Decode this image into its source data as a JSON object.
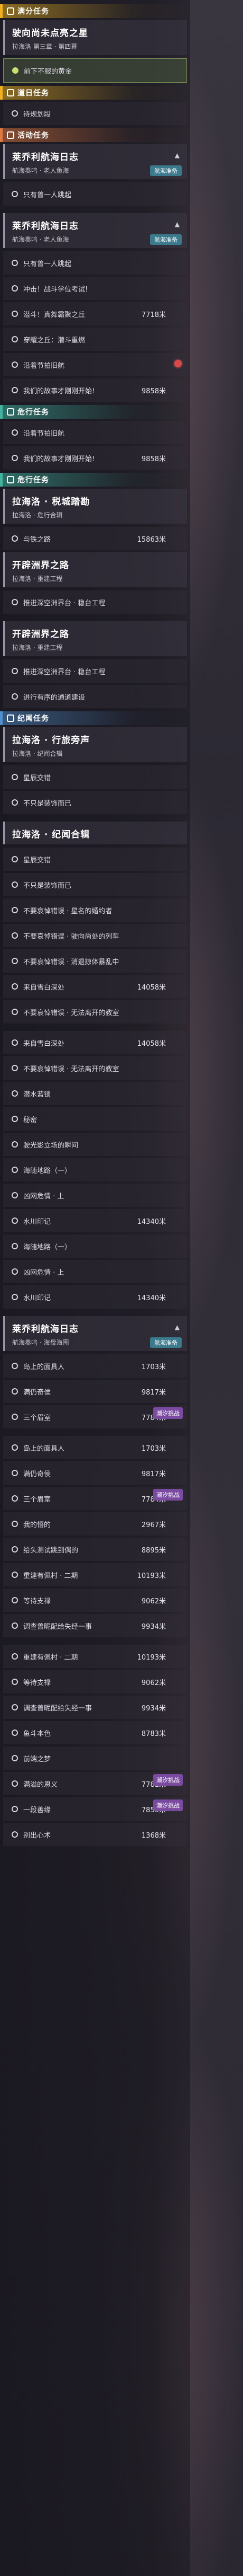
{
  "colors": {
    "trailblaze": "#f0b020",
    "companion": "#e07840",
    "adventure": "#40b4a0",
    "daily": "#5090d0",
    "active_step": "#c8e070",
    "marker": "#d84a4a"
  },
  "items": [
    {
      "k": "cat",
      "c": "yellow",
      "label": "满分任务"
    },
    {
      "k": "quest",
      "title": "驶向尚未点亮之星",
      "sub": "拉海洛 第三章 · 第四幕"
    },
    {
      "k": "step",
      "text": "前下不服的黄金",
      "active": true
    },
    {
      "k": "cat",
      "c": "yellow",
      "label": "道日任务"
    },
    {
      "k": "step",
      "text": "待规划段"
    },
    {
      "k": "cat",
      "c": "orange",
      "label": "活动任务"
    },
    {
      "k": "quest",
      "title": "莱乔利航海日志",
      "sub": "航海奏鸣 · 老人鱼海",
      "tag": "航海准备",
      "arrow": true
    },
    {
      "k": "step",
      "text": "只有曾一人跳起"
    },
    {
      "k": "gap"
    },
    {
      "k": "quest",
      "title": "莱乔利航海日志",
      "sub": "航海奏鸣 · 老人鱼海",
      "tag": "航海准备",
      "arrow": true
    },
    {
      "k": "step",
      "text": "只有曾一人跳起"
    },
    {
      "k": "step",
      "text": "冲击！战斗学位考试!"
    },
    {
      "k": "step",
      "text": "潜斗！真舞霸聚之丘",
      "dist": "7718米"
    },
    {
      "k": "step",
      "text": "穿耀之丘：潜斗重燃"
    },
    {
      "k": "step",
      "text": "沿着节拍旧航",
      "marker": true
    },
    {
      "k": "step",
      "text": "我们的故事才刚刚开始!",
      "dist": "9858米"
    },
    {
      "k": "cat",
      "c": "teal",
      "label": "危行任务"
    },
    {
      "k": "step",
      "text": "沿着节拍旧航"
    },
    {
      "k": "step",
      "text": "我们的故事才刚刚开始!",
      "dist": "9858米"
    },
    {
      "k": "cat",
      "c": "teal",
      "label": "危行任务"
    },
    {
      "k": "quest",
      "title": "拉海洛 · 税城踏勘",
      "sub": "拉海洛 · 危行合辑"
    },
    {
      "k": "step",
      "text": "与铁之路",
      "dist": "15863米"
    },
    {
      "k": "quest",
      "title": "开辟洲界之路",
      "sub": "拉海洛 · 重建工程"
    },
    {
      "k": "step",
      "text": "推进深空洲界台 · 稳台工程"
    },
    {
      "k": "gap"
    },
    {
      "k": "quest",
      "title": "开辟洲界之路",
      "sub": "拉海洛 · 重建工程"
    },
    {
      "k": "step",
      "text": "推进深空洲界台 · 稳台工程"
    },
    {
      "k": "step",
      "text": "进行有序的通道建设"
    },
    {
      "k": "cat",
      "c": "blue",
      "label": "纪闻任务"
    },
    {
      "k": "quest",
      "title": "拉海洛 · 行旅旁声",
      "sub": "拉海洛 · 纪闻合辑"
    },
    {
      "k": "step",
      "text": "星辰交错"
    },
    {
      "k": "step",
      "text": "不只是装饰而已"
    },
    {
      "k": "gap"
    },
    {
      "k": "quest",
      "title": "拉海洛 · 纪闻合辑",
      "sub": "",
      "sub_only": true
    },
    {
      "k": "step",
      "text": "星辰交错"
    },
    {
      "k": "step",
      "text": "不只是装饰而已"
    },
    {
      "k": "step",
      "text": "不要哀悼错误 · 星名的婚约者"
    },
    {
      "k": "step",
      "text": "不要哀悼错误 · 驶向尚处的列车"
    },
    {
      "k": "step",
      "text": "不要哀悼错误 · 消退掠体暴乱中"
    },
    {
      "k": "step",
      "text": "来自雪白深处",
      "dist": "14058米"
    },
    {
      "k": "step",
      "text": "不要哀悼错误 · 无法离开的教室"
    },
    {
      "k": "gap"
    },
    {
      "k": "step",
      "text": "来自雪白深处",
      "dist": "14058米"
    },
    {
      "k": "step",
      "text": "不要哀悼错误 · 无法离开的教室"
    },
    {
      "k": "step",
      "text": "潜水蓝锁"
    },
    {
      "k": "step",
      "text": "秘密"
    },
    {
      "k": "step",
      "text": "驶光影立场的瞬间"
    },
    {
      "k": "step",
      "text": "海随地路（一）"
    },
    {
      "k": "step",
      "text": "凶网危情 · 上"
    },
    {
      "k": "step",
      "text": "水川印记",
      "dist": "14340米"
    },
    {
      "k": "step",
      "text": "海随地路（一）"
    },
    {
      "k": "step",
      "text": "凶网危情 · 上"
    },
    {
      "k": "step",
      "text": "水川印记",
      "dist": "14340米"
    },
    {
      "k": "gap"
    },
    {
      "k": "quest",
      "title": "莱乔利航海日志",
      "sub": "航海奏鸣 · 海母海图",
      "tag": "航海准备",
      "arrow": true
    },
    {
      "k": "step",
      "text": "岛上的面具人",
      "dist": "1703米"
    },
    {
      "k": "step",
      "text": "满仍奇侯",
      "dist": "9817米"
    },
    {
      "k": "step",
      "text": "三个眉室",
      "dist": "7784米",
      "badge": "潮汐挑战"
    },
    {
      "k": "gap"
    },
    {
      "k": "step",
      "text": "岛上的面具人",
      "dist": "1703米"
    },
    {
      "k": "step",
      "text": "满仍奇侯",
      "dist": "9817米"
    },
    {
      "k": "step",
      "text": "三个眉室",
      "dist": "7784米",
      "badge": "潮汐挑战"
    },
    {
      "k": "step",
      "text": "我的悟的",
      "dist": "2967米"
    },
    {
      "k": "step",
      "text": "给头测试跳到偶的",
      "dist": "8895米"
    },
    {
      "k": "step",
      "text": "重建有佩村 · 二期",
      "dist": "10193米"
    },
    {
      "k": "step",
      "text": "等待支禄",
      "dist": "9062米"
    },
    {
      "k": "step",
      "text": "调查曾昵配给失经一事",
      "dist": "9934米"
    },
    {
      "k": "gap"
    },
    {
      "k": "step",
      "text": "重建有佩村 · 二期",
      "dist": "10193米"
    },
    {
      "k": "step",
      "text": "等待支禄",
      "dist": "9062米"
    },
    {
      "k": "step",
      "text": "调查曾昵配给失经一事",
      "dist": "9934米"
    },
    {
      "k": "step",
      "text": "鱼斗本色",
      "dist": "8783米"
    },
    {
      "k": "step",
      "text": "前端之梦"
    },
    {
      "k": "step",
      "text": "满溢的恩义",
      "dist": "7781米",
      "badge": "潮汐挑战"
    },
    {
      "k": "step",
      "text": "一段善缘",
      "dist": "7850米",
      "badge": "潮汐挑战"
    },
    {
      "k": "step",
      "text": "别出心术",
      "dist": "1368米"
    }
  ]
}
